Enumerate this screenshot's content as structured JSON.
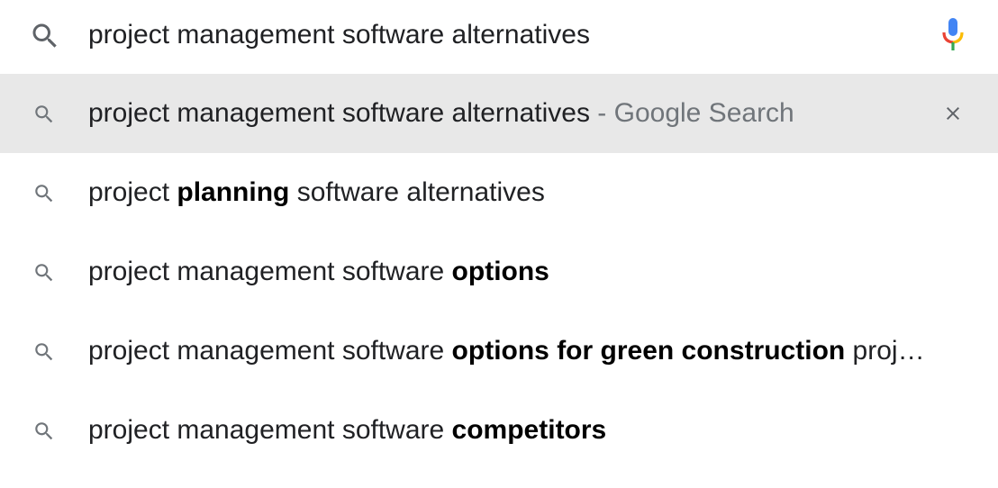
{
  "search": {
    "query": "project management software alternatives",
    "mic_colors": {
      "blue": "#4285F4",
      "red": "#EA4335",
      "yellow": "#FBBC05",
      "green": "#34A853"
    }
  },
  "suggestions": [
    {
      "parts": [
        {
          "text": "project management software alternatives",
          "bold": false
        }
      ],
      "suffix": " - Google Search",
      "highlighted": true,
      "removable": true
    },
    {
      "parts": [
        {
          "text": "project ",
          "bold": false
        },
        {
          "text": "planning",
          "bold": true
        },
        {
          "text": " software alternatives",
          "bold": false
        }
      ]
    },
    {
      "parts": [
        {
          "text": "project management software ",
          "bold": false
        },
        {
          "text": "options",
          "bold": true
        }
      ]
    },
    {
      "parts": [
        {
          "text": "project management software ",
          "bold": false
        },
        {
          "text": "options for green construction",
          "bold": true
        },
        {
          "text": " proj…",
          "bold": false
        }
      ]
    },
    {
      "parts": [
        {
          "text": "project management software ",
          "bold": false
        },
        {
          "text": "competitors",
          "bold": true
        }
      ]
    }
  ],
  "icons": {
    "search": "search-icon",
    "mic": "mic-icon",
    "remove": "close-icon"
  }
}
